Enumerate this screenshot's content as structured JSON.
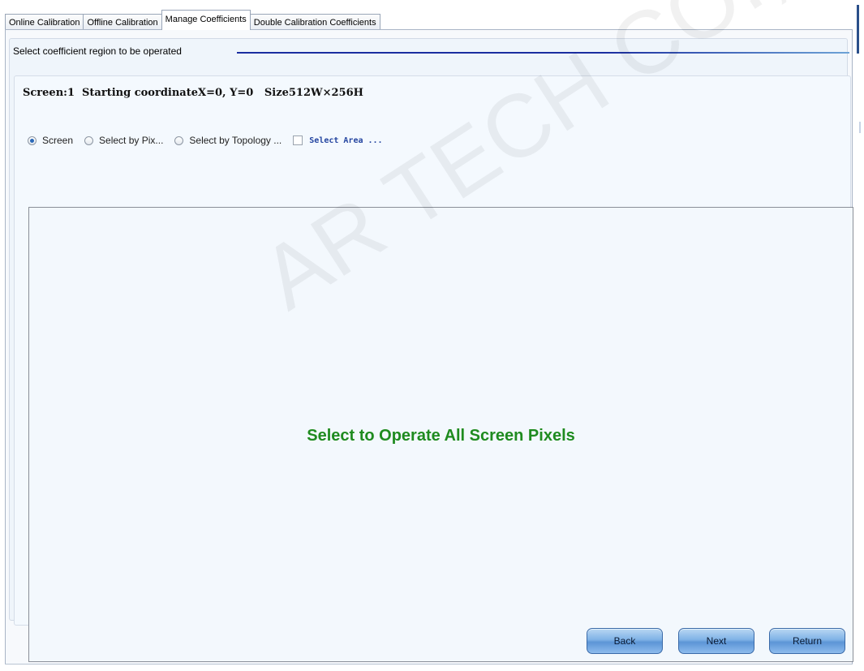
{
  "tabs": [
    {
      "label": "Online Calibration",
      "active": false
    },
    {
      "label": "Offline Calibration",
      "active": false
    },
    {
      "label": "Manage Coefficients",
      "active": true
    },
    {
      "label": "Double Calibration Coefficients",
      "active": false
    }
  ],
  "group": {
    "title": "Select coefficient region to be operated",
    "info": "Screen:1  Starting coordinateX=0, Y=0   Size512W×256H"
  },
  "options": {
    "screen": "Screen",
    "select_by_pixel": "Select by Pix...",
    "select_by_topology": "Select by Topology ...",
    "select_area": "Select Area ...",
    "selected": "Screen",
    "select_area_checked": false
  },
  "canvas": {
    "message": "Select to Operate All Screen Pixels"
  },
  "buttons": {
    "back": "Back",
    "next": "Next",
    "return": "Return"
  },
  "watermark": "AR TECH CO.,LTD.",
  "colors": {
    "message_green": "#1f8b1f",
    "link_blue": "#2445a0",
    "accent_blue": "#1b2ea0"
  }
}
